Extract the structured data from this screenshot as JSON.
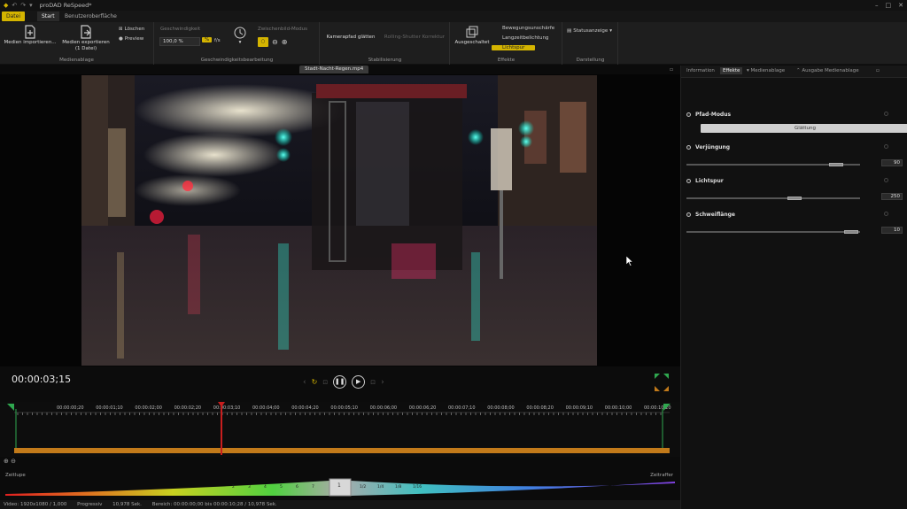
{
  "window": {
    "title": "proDAD ReSpeed*",
    "controls": [
      "–",
      "□",
      "✕"
    ]
  },
  "tabs": {
    "datei": "Datei",
    "start": "Start",
    "ui": "Benutzeroberfläche"
  },
  "ribbon": {
    "medienablage": {
      "label": "Medienablage",
      "import_label": "Medien importieren...",
      "export_label": "Medien exportieren",
      "export_sub": "(1 Datei)",
      "loeschen": "Löschen",
      "preview": "Preview"
    },
    "geschwindigkeit": {
      "label": "Geschwindigkeitsbearbeitung",
      "title": "Geschwindigkeit",
      "value": "100,0 %",
      "percent_btn": "%",
      "fs_btn": "f/s",
      "zwischenbild": "Zwischenbild-Modus"
    },
    "stabilisierung": {
      "label": "Stabilisierung",
      "kamerapfad": "Kamerapfad glätten",
      "rolling": "Rolling-Shutter Korrektur"
    },
    "effekte": {
      "label": "Effekte",
      "ausgeschaltet": "Ausgeschaltet",
      "bewegung": "Bewegungsunschärfe",
      "langzeit": "Langzeitbelichtung",
      "lichtspur": "Lichtspur"
    },
    "darstellung": {
      "label": "Darstellung",
      "statusanzeige": "Statusanzeige"
    }
  },
  "file_tab": "Stadt-Nacht-Regen.mp4",
  "right_panel": {
    "tabs": [
      "Information",
      "Effekte",
      "Medienablage",
      "Ausgabe Medienablage"
    ],
    "pfad_modus": {
      "label": "Pfad-Modus",
      "value": "Glättung"
    },
    "params": [
      {
        "label": "Verjüngung",
        "value": "90",
        "level": 0.86
      },
      {
        "label": "Lichtspur",
        "value": "250",
        "level": 0.62
      },
      {
        "label": "Schweiflänge",
        "value": "10",
        "level": 0.95
      }
    ]
  },
  "transport": {
    "timecode": "00:00:03;15"
  },
  "timeline": {
    "ticks": [
      "00:00:00;20",
      "00:00:01;10",
      "00:00:02;00",
      "00:00:02;20",
      "00:00:03;10",
      "00:00:04;00",
      "00:00:04;20",
      "00:00:05;10",
      "00:00:06;00",
      "00:00:06;20",
      "00:00:07;10",
      "00:00:08;00",
      "00:00:08;20",
      "00:00:09;10",
      "00:00:10;00",
      "00:00:10;20"
    ],
    "playhead_fraction": 0.32
  },
  "speed_curve": {
    "left_label": "Zeitlupe",
    "right_label": "Zeitraffer",
    "center_value": "1",
    "left_cells": [
      "2",
      "3",
      "4",
      "5",
      "6",
      "7"
    ],
    "right_cells": [
      "1/2",
      "1/4",
      "1/8",
      "1/16"
    ]
  },
  "status": {
    "video": "Video: 1920x1080 / 1,000",
    "mode": "Progressiv",
    "duration": "10,978 Sek.",
    "range": "Bereich: 00:00:00;00 bis 00:00:10;28 / 10,978 Sek."
  },
  "colors": {
    "accent": "#d4b400",
    "playhead": "#c81e1e",
    "track": "#c27a1a",
    "marker": "#2fa84f"
  }
}
